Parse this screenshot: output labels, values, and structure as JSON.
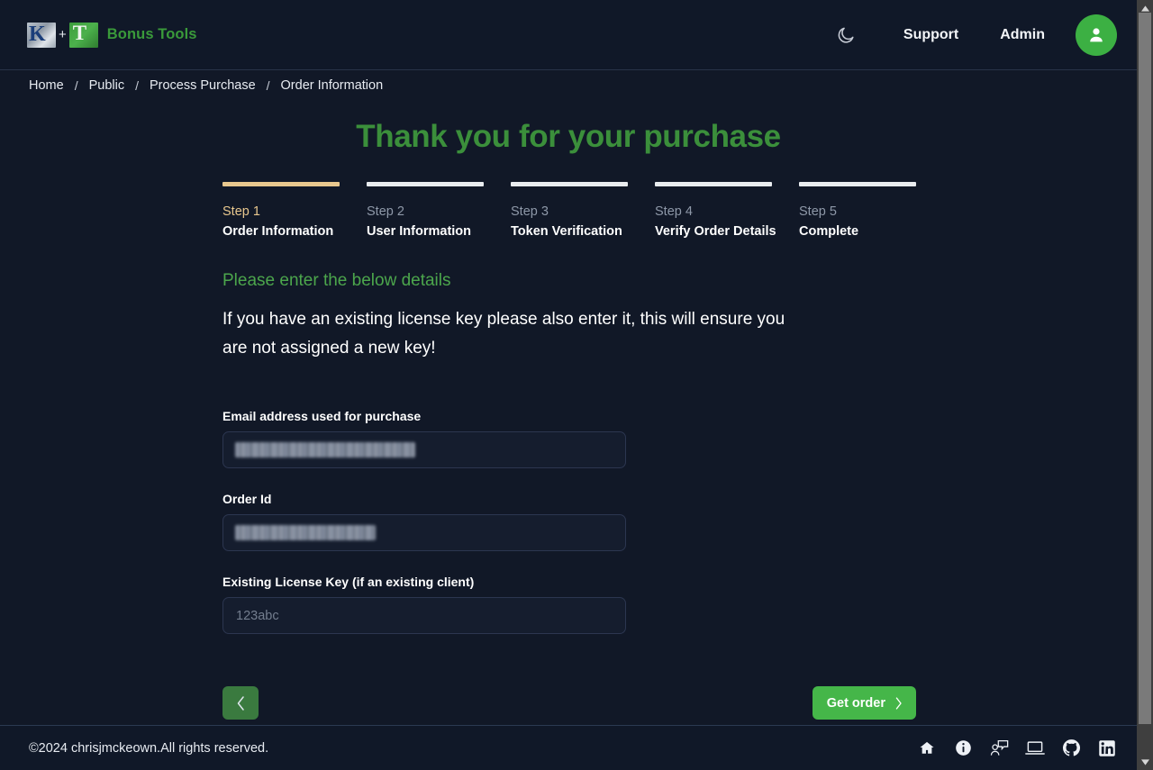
{
  "header": {
    "brand_name": "Bonus Tools",
    "brand_plus": "+",
    "logo_left_letter": "K",
    "logo_right_letter": "T",
    "theme_toggle_icon": "moon-icon",
    "links": [
      {
        "label": "Support"
      },
      {
        "label": "Admin"
      }
    ],
    "avatar_icon": "user-icon"
  },
  "breadcrumb": {
    "separator": "/",
    "items": [
      {
        "label": "Home"
      },
      {
        "label": "Public"
      },
      {
        "label": "Process Purchase"
      },
      {
        "label": "Order Information"
      }
    ]
  },
  "main": {
    "page_title": "Thank you for your purchase",
    "stepper": [
      {
        "num": "Step 1",
        "label": "Order Information",
        "active": true
      },
      {
        "num": "Step 2",
        "label": "User Information",
        "active": false
      },
      {
        "num": "Step 3",
        "label": "Token Verification",
        "active": false
      },
      {
        "num": "Step 4",
        "label": "Verify Order Details",
        "active": false
      },
      {
        "num": "Step 5",
        "label": "Complete",
        "active": false
      }
    ],
    "intro_heading": "Please enter the below details",
    "intro_body": "If you have an existing license key please also enter it, this will ensure you are not assigned a new key!",
    "fields": {
      "email": {
        "label": "Email address used for purchase",
        "value": "",
        "placeholder": "",
        "redacted": true
      },
      "order_id": {
        "label": "Order Id",
        "value": "",
        "placeholder": "",
        "redacted": true
      },
      "license_key": {
        "label": "Existing License Key (if an existing client)",
        "value": "",
        "placeholder": "123abc",
        "redacted": false
      }
    },
    "buttons": {
      "back_icon": "chevron-left-icon",
      "next_label": "Get order",
      "next_icon": "chevron-right-icon"
    }
  },
  "footer": {
    "copyright": "©2024 chrisjmckeown.All rights reserved.",
    "icons": [
      {
        "name": "home-icon"
      },
      {
        "name": "info-icon"
      },
      {
        "name": "contact-icon"
      },
      {
        "name": "laptop-icon"
      },
      {
        "name": "github-icon"
      },
      {
        "name": "linkedin-icon"
      }
    ]
  },
  "colors": {
    "page_bg": "#111827",
    "header_bg": "#101828",
    "brand_green": "#3a9a3a",
    "title_green": "#3b8f3b",
    "accent_green": "#45b649",
    "back_green": "#3a7a3f",
    "step_active": "#e8c78e",
    "step_inactive": "#e9ecef",
    "input_border": "#2c3650",
    "text_primary": "#ffffff",
    "text_muted": "#8e98a8",
    "scrollbar_track": "#3f3f3f",
    "scrollbar_thumb": "#7a7a7a"
  },
  "scrollbar": {
    "up_arrow": "▲",
    "down_arrow": "▼"
  }
}
